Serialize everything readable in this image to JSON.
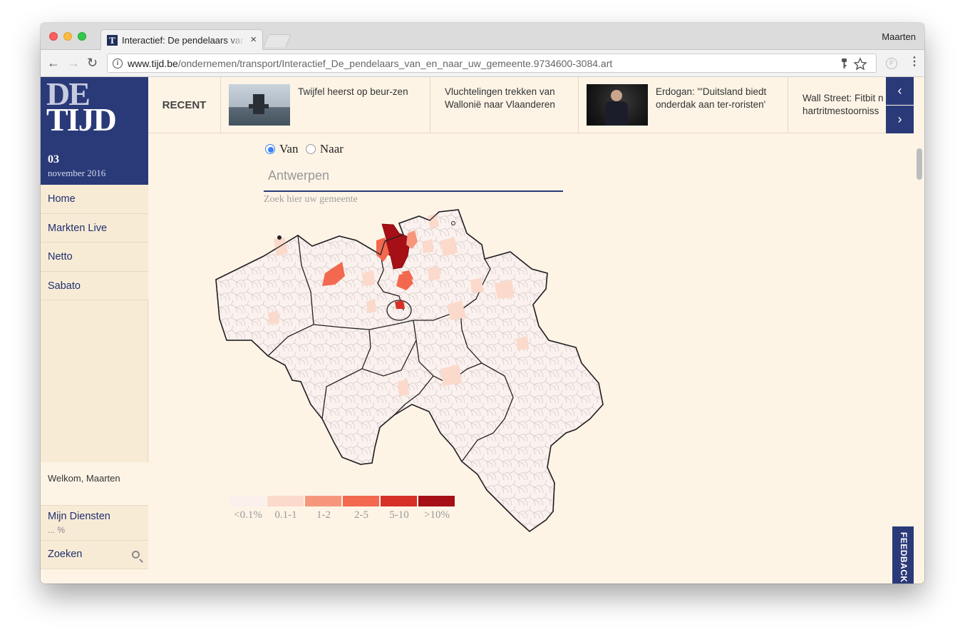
{
  "browser": {
    "tab_title": "Interactief: De pendelaars van en naar uw gemeente",
    "tab_favicon_letter": "T",
    "tab_close": "×",
    "profile_name": "Maarten",
    "url_host": "www.tijd.be",
    "url_path": "/ondernemen/transport/Interactief_De_pendelaars_van_en_naar_uw_gemeente.9734600-3084.art",
    "nav": {
      "back": "←",
      "forward": "→",
      "reload": "↻"
    },
    "menu": "⋮"
  },
  "sidebar": {
    "logo_line1": "DE",
    "logo_line2": "TIJD",
    "date_day": "03",
    "date_month": "november 2016",
    "items": [
      {
        "label": "Home"
      },
      {
        "label": "Markten Live"
      },
      {
        "label": "Netto"
      },
      {
        "label": "Sabato"
      }
    ],
    "welcome": "Welkom, Maarten",
    "mijn_diensten": "Mijn Diensten",
    "mijn_diensten_sub": "... %",
    "zoeken": "Zoeken"
  },
  "recent": {
    "label": "RECENT",
    "items": [
      {
        "title": "Twijfel heerst op beur-zen",
        "has_image": true
      },
      {
        "title": "Vluchtelingen trekken van Wallonië naar Vlaanderen",
        "has_image": false
      },
      {
        "title": "Erdogan: \"'Duitsland biedt onderdak aan ter-roristen'",
        "has_image": true
      },
      {
        "title": "Wall Street: Fitbit n hartritmestoorniss",
        "has_image": false
      }
    ],
    "prev": "‹",
    "next": "›"
  },
  "controls": {
    "options": [
      {
        "label": "Van",
        "selected": true
      },
      {
        "label": "Naar",
        "selected": false
      }
    ],
    "search_value": "Antwerpen",
    "search_hint": "Zoek hier uw gemeente"
  },
  "map": {
    "selected_municipality": "Antwerpen",
    "direction": "Van"
  },
  "legend": {
    "classes": [
      {
        "label": "<0.1%",
        "color": "#fcf0ec"
      },
      {
        "label": "0.1-1",
        "color": "#fbd9cb"
      },
      {
        "label": "1-2",
        "color": "#f6977d"
      },
      {
        "label": "2-5",
        "color": "#f2694f"
      },
      {
        "label": "5-10",
        "color": "#d63027"
      },
      {
        "label": ">10%",
        "color": "#a50f15"
      }
    ]
  },
  "feedback": "FEEDBACK",
  "colors": {
    "brand_navy": "#2a3a78",
    "page_bg": "#fdf4e6",
    "sidebar_bg": "#f8ebd6"
  }
}
